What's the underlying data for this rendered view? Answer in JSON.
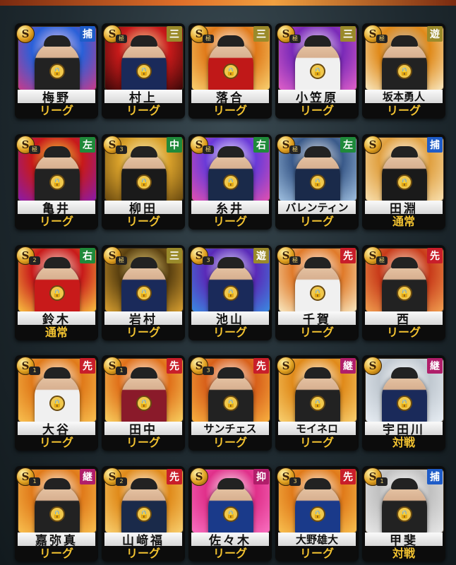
{
  "colors": {
    "position_blue": "#1e5cc8",
    "position_green": "#1f8a3a",
    "position_olive": "#9a8a2a",
    "position_red": "#c81e2a",
    "position_purple": "#b01e6a",
    "type_label": "#f2c230"
  },
  "cards": [
    {
      "rank": "S",
      "rank_sub": "",
      "position": "捕",
      "pos_color": "blue",
      "name": "梅野",
      "type": "リーグ",
      "art": [
        "#2a60d8",
        "#c83a8a",
        "#f0d0f0"
      ],
      "uniform": "#222"
    },
    {
      "rank": "S",
      "rank_sub": "極",
      "position": "三",
      "pos_color": "olive",
      "name": "村上",
      "type": "リーグ",
      "art": [
        "#c81a1a",
        "#3a0808",
        "#f8e0a0"
      ],
      "uniform": "#1a2a5a"
    },
    {
      "rank": "S",
      "rank_sub": "極",
      "position": "三",
      "pos_color": "olive",
      "name": "落合",
      "type": "リーグ",
      "art": [
        "#e07a1a",
        "#f8d070",
        "#ffffff"
      ],
      "uniform": "#c01818"
    },
    {
      "rank": "S",
      "rank_sub": "極",
      "position": "三",
      "pos_color": "olive",
      "name": "小笠原",
      "type": "リーグ",
      "art": [
        "#7a2ab8",
        "#e060c8",
        "#f8f0ff"
      ],
      "uniform": "#f0f0f0"
    },
    {
      "rank": "S",
      "rank_sub": "極",
      "position": "遊",
      "pos_color": "olive",
      "name": "坂本勇人",
      "type": "リーグ",
      "art": [
        "#e08a1a",
        "#f8e8c0",
        "#c0c0c0"
      ],
      "uniform": "#222"
    },
    {
      "rank": "S",
      "rank_sub": "極",
      "position": "左",
      "pos_color": "green",
      "name": "亀井",
      "type": "リーグ",
      "art": [
        "#c81a1a",
        "#8a1aa8",
        "#f8e040"
      ],
      "uniform": "#222"
    },
    {
      "rank": "S",
      "rank_sub": "3",
      "position": "中",
      "pos_color": "green",
      "name": "柳田",
      "type": "リーグ",
      "art": [
        "#d8a02a",
        "#6a4a10",
        "#f8f0c0"
      ],
      "uniform": "#1a1a1a"
    },
    {
      "rank": "S",
      "rank_sub": "極",
      "position": "右",
      "pos_color": "green",
      "name": "糸井",
      "type": "リーグ",
      "art": [
        "#6a3ad8",
        "#e050b0",
        "#ffffff"
      ],
      "uniform": "#1a2a4a"
    },
    {
      "rank": "S",
      "rank_sub": "極",
      "position": "左",
      "pos_color": "green",
      "name": "バレンティン",
      "type": "リーグ",
      "art": [
        "#3a5a8a",
        "#a0c0e0",
        "#f0f0f0"
      ],
      "uniform": "#1a2a4a"
    },
    {
      "rank": "S",
      "rank_sub": "",
      "position": "捕",
      "pos_color": "blue",
      "name": "田淵",
      "type": "通常",
      "art": [
        "#e0a040",
        "#f8e0b0",
        "#ffffff"
      ],
      "uniform": "#1a1a1a"
    },
    {
      "rank": "S",
      "rank_sub": "2",
      "position": "右",
      "pos_color": "green",
      "name": "鈴木",
      "type": "通常",
      "art": [
        "#c81a1a",
        "#f8c040",
        "#f8f0e0"
      ],
      "uniform": "#c81a1a"
    },
    {
      "rank": "S",
      "rank_sub": "極",
      "position": "三",
      "pos_color": "olive",
      "name": "岩村",
      "type": "リーグ",
      "art": [
        "#5a4010",
        "#d8a030",
        "#f0d880"
      ],
      "uniform": "#1a2a5a"
    },
    {
      "rank": "S",
      "rank_sub": "3",
      "position": "遊",
      "pos_color": "olive",
      "name": "池山",
      "type": "リーグ",
      "art": [
        "#5a2ab8",
        "#3a8ae0",
        "#f0f0ff"
      ],
      "uniform": "#1a2a5a"
    },
    {
      "rank": "S",
      "rank_sub": "極",
      "position": "先",
      "pos_color": "red",
      "name": "千賀",
      "type": "リーグ",
      "art": [
        "#e07a2a",
        "#f8e8c0",
        "#ffffff"
      ],
      "uniform": "#f0f0f0"
    },
    {
      "rank": "S",
      "rank_sub": "極",
      "position": "先",
      "pos_color": "red",
      "name": "西",
      "type": "リーグ",
      "art": [
        "#c83a1a",
        "#f0a050",
        "#f8e8d0"
      ],
      "uniform": "#222"
    },
    {
      "rank": "S",
      "rank_sub": "1",
      "position": "先",
      "pos_color": "red",
      "name": "大谷",
      "type": "リーグ",
      "art": [
        "#e07a1a",
        "#f8c050",
        "#ffffff"
      ],
      "uniform": "#f0f0f0"
    },
    {
      "rank": "S",
      "rank_sub": "1",
      "position": "先",
      "pos_color": "red",
      "name": "田中",
      "type": "リーグ",
      "art": [
        "#e0701a",
        "#f8d060",
        "#ffffff"
      ],
      "uniform": "#8a1a2a"
    },
    {
      "rank": "S",
      "rank_sub": "3",
      "position": "先",
      "pos_color": "red",
      "name": "サンチェス",
      "type": "リーグ",
      "art": [
        "#d8601a",
        "#f8b040",
        "#ffffff"
      ],
      "uniform": "#222"
    },
    {
      "rank": "S",
      "rank_sub": "",
      "position": "継",
      "pos_color": "purple",
      "name": "モイネロ",
      "type": "リーグ",
      "art": [
        "#e08a1a",
        "#f8d070",
        "#ffffff"
      ],
      "uniform": "#222"
    },
    {
      "rank": "S",
      "rank_sub": "",
      "position": "継",
      "pos_color": "purple",
      "name": "宇田川",
      "type": "対戦",
      "art": [
        "#c0c8d0",
        "#e8eef4",
        "#ffffff"
      ],
      "uniform": "#1a2a5a"
    },
    {
      "rank": "S",
      "rank_sub": "1",
      "position": "継",
      "pos_color": "purple",
      "name": "嘉弥真",
      "type": "リーグ",
      "art": [
        "#e07a1a",
        "#f8c050",
        "#ffffff"
      ],
      "uniform": "#222"
    },
    {
      "rank": "S",
      "rank_sub": "2",
      "position": "先",
      "pos_color": "red",
      "name": "山﨑福",
      "type": "リーグ",
      "art": [
        "#e08a1a",
        "#f8d070",
        "#ffffff"
      ],
      "uniform": "#1a2a4a"
    },
    {
      "rank": "S",
      "rank_sub": "",
      "position": "抑",
      "pos_color": "purple",
      "name": "佐々木",
      "type": "リーグ",
      "art": [
        "#e0308a",
        "#f870c0",
        "#ffffff"
      ],
      "uniform": "#1a3a8a"
    },
    {
      "rank": "S",
      "rank_sub": "3",
      "position": "先",
      "pos_color": "red",
      "name": "大野雄大",
      "type": "リーグ",
      "art": [
        "#e07a1a",
        "#f8c050",
        "#ffffff"
      ],
      "uniform": "#1a3a8a"
    },
    {
      "rank": "S",
      "rank_sub": "1",
      "position": "捕",
      "pos_color": "blue",
      "name": "甲斐",
      "type": "対戦",
      "art": [
        "#c0c0c0",
        "#e8e8e8",
        "#ffffff"
      ],
      "uniform": "#222"
    }
  ]
}
